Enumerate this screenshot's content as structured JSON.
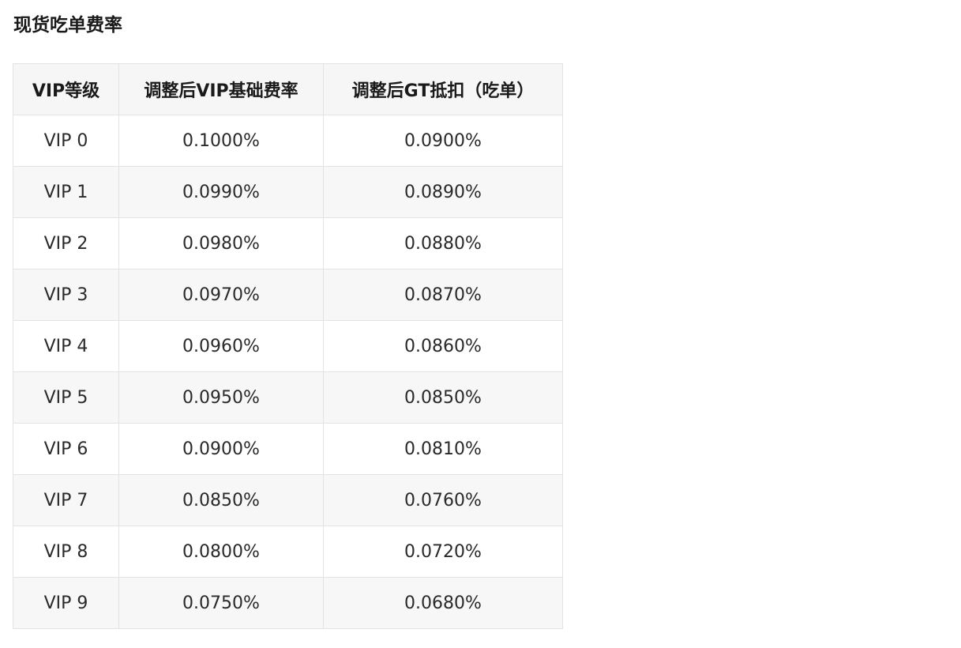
{
  "title": "现货吃单费率",
  "table": {
    "headers": [
      "VIP等级",
      "调整后VIP基础费率",
      "调整后GT抵扣（吃单）"
    ],
    "rows": [
      [
        "VIP 0",
        "0.1000%",
        "0.0900%"
      ],
      [
        "VIP 1",
        "0.0990%",
        "0.0890%"
      ],
      [
        "VIP 2",
        "0.0980%",
        "0.0880%"
      ],
      [
        "VIP 3",
        "0.0970%",
        "0.0870%"
      ],
      [
        "VIP 4",
        "0.0960%",
        "0.0860%"
      ],
      [
        "VIP 5",
        "0.0950%",
        "0.0850%"
      ],
      [
        "VIP 6",
        "0.0900%",
        "0.0810%"
      ],
      [
        "VIP 7",
        "0.0850%",
        "0.0760%"
      ],
      [
        "VIP 8",
        "0.0800%",
        "0.0720%"
      ],
      [
        "VIP 9",
        "0.0750%",
        "0.0680%"
      ]
    ]
  }
}
